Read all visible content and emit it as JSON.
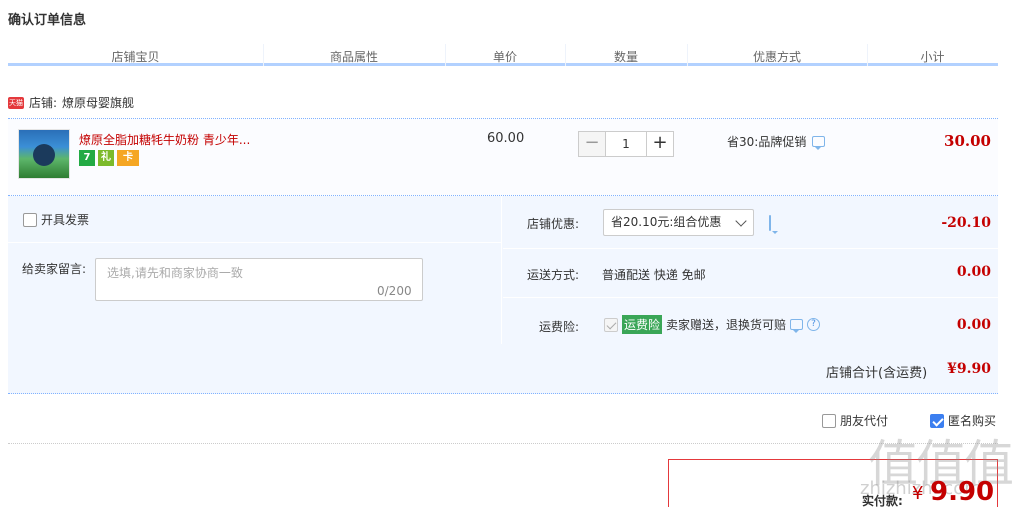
{
  "page": {
    "title": "确认订单信息"
  },
  "columns": [
    "店铺宝贝",
    "商品属性",
    "单价",
    "数量",
    "优惠方式",
    "小计"
  ],
  "shop": {
    "prefix": "店铺:",
    "name": "燎原母婴旗舰",
    "tmall_badge": "天猫"
  },
  "item": {
    "title": "燎原全脂加糖牦牛奶粉 青少年...",
    "unit_price": "60.00",
    "quantity": "1",
    "promo": "省30:品牌促销",
    "subtotal": "30.00",
    "badges": [
      "7",
      "礼",
      "卡"
    ]
  },
  "extras": {
    "invoice_label": "开具发票",
    "message_label": "给卖家留言:",
    "message_placeholder": "选填,请先和商家协商一致",
    "message_count": "0/200",
    "shop_discount_label": "店铺优惠:",
    "shop_discount_option": "省20.10元:组合优惠",
    "shop_discount_amount": "-20.10",
    "shipping_label": "运送方式:",
    "shipping_value": "普通配送 快递 免邮",
    "shipping_amount": "0.00",
    "insurance_label": "运费险:",
    "insurance_badge": "运费险",
    "insurance_text": "卖家赠送，退换货可赔",
    "insurance_amount": "0.00"
  },
  "total": {
    "label": "店铺合计(含运费)",
    "value": "¥9.90"
  },
  "options": {
    "friend_pay": "朋友代付",
    "anonymous": "匿名购买",
    "anonymous_checked": true
  },
  "payment": {
    "label": "实付款:",
    "currency": "¥",
    "amount": "9.90"
  },
  "watermark": {
    "main": "值值值",
    "sub": "zhizhizhi.com"
  },
  "colors": {
    "accent_red": "#c40000",
    "light_blue": "#f2f7ff",
    "blue_border": "#b2d1ff",
    "check_blue": "#3c7ff0"
  }
}
